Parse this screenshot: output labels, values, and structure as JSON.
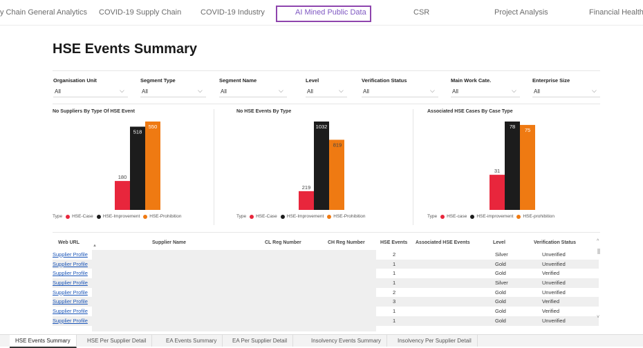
{
  "nav": {
    "items": [
      "y Chain General Analytics",
      "COVID-19 Supply Chain",
      "COVID-19 Industry",
      "AI Mined Public Data",
      "CSR",
      "Project Analysis",
      "Financial Health"
    ],
    "active": "AI Mined Public Data"
  },
  "page": {
    "title": "HSE Events Summary"
  },
  "filters": [
    {
      "label": "Organisation Unit",
      "value": "All"
    },
    {
      "label": "Segment Type",
      "value": "All"
    },
    {
      "label": "Segment Name",
      "value": "All"
    },
    {
      "label": "Level",
      "value": "All"
    },
    {
      "label": "Verification Status",
      "value": "All"
    },
    {
      "label": "Main Work Cate.",
      "value": "All"
    },
    {
      "label": "Enterprise Size",
      "value": "All"
    }
  ],
  "chart_data": [
    {
      "type": "bar",
      "title": "No Suppliers By Type Of HSE Event",
      "categories": [
        "HSE-Case",
        "HSE-Improvement",
        "HSE-Prohibition"
      ],
      "values": [
        180,
        518,
        550
      ],
      "ylim": [
        0,
        550
      ],
      "legend_title": "Type",
      "legend_position": "bottom-left",
      "grid": false
    },
    {
      "type": "bar",
      "title": "No HSE Events By Type",
      "categories": [
        "HSE-Case",
        "HSE-Improvement",
        "HSE-Prohibition"
      ],
      "values": [
        219,
        1032,
        819
      ],
      "ylim": [
        0,
        1032
      ],
      "legend_title": "Type",
      "legend_position": "bottom-left",
      "grid": false
    },
    {
      "type": "bar",
      "title": "Associated HSE Cases By Case Type",
      "categories": [
        "HSE-case",
        "HSE-improvement",
        "HSE-prohibition"
      ],
      "values": [
        31,
        78,
        75
      ],
      "ylim": [
        0,
        78
      ],
      "legend_title": "Type",
      "legend_position": "bottom-left",
      "grid": false
    }
  ],
  "colors": {
    "case": "#e8263c",
    "improvement": "#1c1c1c",
    "prohibition": "#ef7a12",
    "nav_active": "#8e44ad",
    "link": "#1a55b8"
  },
  "table": {
    "headers": {
      "web_url": "Web URL",
      "supplier_name": "Supplier Name",
      "cl_reg": "CL Reg Number",
      "ch_reg": "CH Reg Number",
      "hse_events": "HSE Events",
      "assoc": "Associated HSE Events",
      "level": "Level",
      "verification": "Verification Status"
    },
    "rows": [
      {
        "link": "Supplier Profile",
        "hse": "2",
        "level": "Silver",
        "status": "Unverified"
      },
      {
        "link": "Supplier Profile",
        "hse": "1",
        "level": "Gold",
        "status": "Unverified"
      },
      {
        "link": "Supplier Profile",
        "hse": "1",
        "level": "Gold",
        "status": "Verified"
      },
      {
        "link": "Supplier Profile",
        "hse": "1",
        "level": "Silver",
        "status": "Unverified"
      },
      {
        "link": "Supplier Profile",
        "hse": "2",
        "level": "Gold",
        "status": "Unverified"
      },
      {
        "link": "Supplier Profile",
        "hse": "3",
        "level": "Gold",
        "status": "Verified"
      },
      {
        "link": "Supplier Profile",
        "hse": "1",
        "level": "Gold",
        "status": "Verified"
      },
      {
        "link": "Supplier Profile",
        "hse": "1",
        "level": "Gold",
        "status": "Unverified"
      }
    ]
  },
  "bottom_tabs": [
    "HSE Events Summary",
    "HSE Per Supplier Detail",
    "EA Events Summary",
    "EA Per Supplier Detail",
    "Insolvency Events Summary",
    "Insolvency Per Supplier Detail"
  ],
  "bottom_active": "HSE Events Summary",
  "icons": {
    "dropdown": "chevron-down-icon",
    "sort": "sort-arrow-icon",
    "scroll_up": "scroll-up-icon",
    "scroll_down": "scroll-down-icon"
  }
}
